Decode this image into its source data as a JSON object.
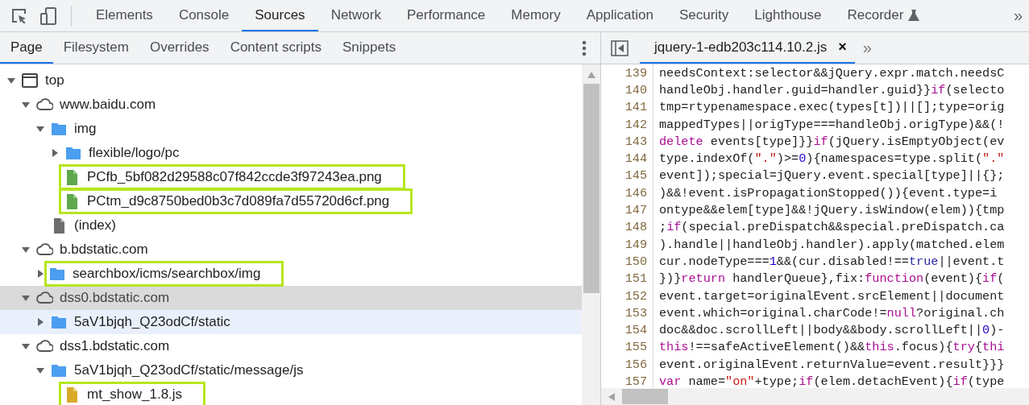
{
  "toolbar": {
    "tabs": [
      {
        "label": "Elements",
        "selected": false
      },
      {
        "label": "Console",
        "selected": false
      },
      {
        "label": "Sources",
        "selected": true
      },
      {
        "label": "Network",
        "selected": false
      },
      {
        "label": "Performance",
        "selected": false
      },
      {
        "label": "Memory",
        "selected": false
      },
      {
        "label": "Application",
        "selected": false
      },
      {
        "label": "Security",
        "selected": false
      },
      {
        "label": "Lighthouse",
        "selected": false
      },
      {
        "label": "Recorder",
        "selected": false,
        "experimental": true
      }
    ],
    "more": "»"
  },
  "navigator": {
    "tabs": [
      {
        "label": "Page",
        "selected": true
      },
      {
        "label": "Filesystem",
        "selected": false
      },
      {
        "label": "Overrides",
        "selected": false
      },
      {
        "label": "Content scripts",
        "selected": false
      },
      {
        "label": "Snippets",
        "selected": false
      }
    ],
    "tree": [
      {
        "label": "top",
        "kind": "frame",
        "expanded": true,
        "selected": false,
        "hovered": false,
        "annotated": false,
        "children": [
          {
            "label": "www.baidu.com",
            "kind": "domain",
            "expanded": true,
            "selected": false,
            "hovered": false,
            "annotated": false,
            "children": [
              {
                "label": "img",
                "kind": "folder",
                "expanded": true,
                "selected": false,
                "hovered": false,
                "annotated": false,
                "children": [
                  {
                    "label": "flexible/logo/pc",
                    "kind": "folder",
                    "expanded": false,
                    "selected": false,
                    "hovered": false,
                    "annotated": false
                  },
                  {
                    "label": "PCfb_5bf082d29588c07f842ccde3f97243ea.png",
                    "kind": "image",
                    "selected": false,
                    "hovered": false,
                    "annotated": true
                  },
                  {
                    "label": "PCtm_d9c8750bed0b3c7d089fa7d55720d6cf.png",
                    "kind": "image",
                    "selected": false,
                    "hovered": false,
                    "annotated": true
                  }
                ]
              },
              {
                "label": "(index)",
                "kind": "document",
                "selected": false,
                "hovered": false,
                "annotated": false
              }
            ]
          },
          {
            "label": "b.bdstatic.com",
            "kind": "domain",
            "expanded": true,
            "selected": false,
            "hovered": false,
            "annotated": false,
            "children": [
              {
                "label": "searchbox/icms/searchbox/img",
                "kind": "folder",
                "expanded": false,
                "selected": false,
                "hovered": false,
                "annotated": true
              }
            ]
          },
          {
            "label": "dss0.bdstatic.com",
            "kind": "domain",
            "expanded": true,
            "selected": true,
            "hovered": false,
            "annotated": false,
            "children": [
              {
                "label": "5aV1bjqh_Q23odCf/static",
                "kind": "folder",
                "expanded": false,
                "selected": false,
                "hovered": true,
                "annotated": false
              }
            ]
          },
          {
            "label": "dss1.bdstatic.com",
            "kind": "domain",
            "expanded": true,
            "selected": false,
            "hovered": false,
            "annotated": false,
            "children": [
              {
                "label": "5aV1bjqh_Q23odCf/static/message/js",
                "kind": "folder",
                "expanded": true,
                "selected": false,
                "hovered": false,
                "annotated": false,
                "children": [
                  {
                    "label": "mt_show_1.8.js",
                    "kind": "script",
                    "selected": false,
                    "hovered": false,
                    "annotated": true
                  }
                ]
              }
            ]
          }
        ]
      }
    ]
  },
  "editor": {
    "tabs": [
      {
        "label": "jquery-1-edb203c114.10.2.js",
        "selected": true,
        "close": "×"
      }
    ],
    "more": "»",
    "lines": [
      {
        "number": "139",
        "tokens": [
          {
            "kind": "plain",
            "text": "needsContext:selector&&jQuery.expr.match.needsC"
          }
        ]
      },
      {
        "number": "140",
        "tokens": [
          {
            "kind": "plain",
            "text": "handleObj.handler.guid=handler.guid}}"
          },
          {
            "kind": "keyword",
            "text": "if"
          },
          {
            "kind": "plain",
            "text": "(selecto"
          }
        ]
      },
      {
        "number": "141",
        "tokens": [
          {
            "kind": "plain",
            "text": "tmp=rtypenamespace.exec(types[t])||[];type=orig"
          }
        ]
      },
      {
        "number": "142",
        "tokens": [
          {
            "kind": "plain",
            "text": "mappedTypes||origType===handleObj.origType)&&(!"
          }
        ]
      },
      {
        "number": "143",
        "tokens": [
          {
            "kind": "keyword",
            "text": "delete"
          },
          {
            "kind": "plain",
            "text": " events[type]}}"
          },
          {
            "kind": "keyword",
            "text": "if"
          },
          {
            "kind": "plain",
            "text": "(jQuery.isEmptyObject(ev"
          }
        ]
      },
      {
        "number": "144",
        "tokens": [
          {
            "kind": "plain",
            "text": "type.indexOf("
          },
          {
            "kind": "string",
            "text": "\".\""
          },
          {
            "kind": "plain",
            "text": ")>="
          },
          {
            "kind": "number",
            "text": "0"
          },
          {
            "kind": "plain",
            "text": "){namespaces=type.split("
          },
          {
            "kind": "string",
            "text": "\".\""
          }
        ]
      },
      {
        "number": "145",
        "tokens": [
          {
            "kind": "plain",
            "text": "event]);special=jQuery.event.special[type]||{};"
          }
        ]
      },
      {
        "number": "146",
        "tokens": [
          {
            "kind": "plain",
            "text": ")&&!event.isPropagationStopped()){event.type=i"
          }
        ]
      },
      {
        "number": "147",
        "tokens": [
          {
            "kind": "plain",
            "text": "ontype&&elem[type]&&!jQuery.isWindow(elem)){tmp"
          }
        ]
      },
      {
        "number": "148",
        "tokens": [
          {
            "kind": "plain",
            "text": ";"
          },
          {
            "kind": "keyword",
            "text": "if"
          },
          {
            "kind": "plain",
            "text": "(special.preDispatch&&special.preDispatch.ca"
          }
        ]
      },
      {
        "number": "149",
        "tokens": [
          {
            "kind": "plain",
            "text": ").handle||handleObj.handler).apply(matched.elem"
          }
        ]
      },
      {
        "number": "150",
        "tokens": [
          {
            "kind": "plain",
            "text": "cur.nodeType==="
          },
          {
            "kind": "number",
            "text": "1"
          },
          {
            "kind": "plain",
            "text": "&&(cur.disabled!=="
          },
          {
            "kind": "atom",
            "text": "true"
          },
          {
            "kind": "plain",
            "text": "||event.t"
          }
        ]
      },
      {
        "number": "151",
        "tokens": [
          {
            "kind": "plain",
            "text": "})}"
          },
          {
            "kind": "keyword",
            "text": "return"
          },
          {
            "kind": "plain",
            "text": " handlerQueue},fix:"
          },
          {
            "kind": "keyword",
            "text": "function"
          },
          {
            "kind": "plain",
            "text": "(event){"
          },
          {
            "kind": "keyword",
            "text": "if"
          },
          {
            "kind": "plain",
            "text": "("
          }
        ]
      },
      {
        "number": "152",
        "tokens": [
          {
            "kind": "plain",
            "text": "event.target=originalEvent.srcElement||document"
          }
        ]
      },
      {
        "number": "153",
        "tokens": [
          {
            "kind": "plain",
            "text": "event.which=original.charCode!="
          },
          {
            "kind": "keyword",
            "text": "null"
          },
          {
            "kind": "plain",
            "text": "?original.ch"
          }
        ]
      },
      {
        "number": "154",
        "tokens": [
          {
            "kind": "plain",
            "text": "doc&&doc.scrollLeft||body&&body.scrollLeft||"
          },
          {
            "kind": "number",
            "text": "0"
          },
          {
            "kind": "plain",
            "text": ")-"
          }
        ]
      },
      {
        "number": "155",
        "tokens": [
          {
            "kind": "keyword",
            "text": "this"
          },
          {
            "kind": "plain",
            "text": "!==safeActiveElement()&&"
          },
          {
            "kind": "keyword",
            "text": "this"
          },
          {
            "kind": "plain",
            "text": ".focus){"
          },
          {
            "kind": "keyword",
            "text": "try"
          },
          {
            "kind": "plain",
            "text": "{"
          },
          {
            "kind": "keyword",
            "text": "thi"
          }
        ]
      },
      {
        "number": "156",
        "tokens": [
          {
            "kind": "plain",
            "text": "event.originalEvent.returnValue=event.result}}}"
          }
        ]
      },
      {
        "number": "157",
        "tokens": [
          {
            "kind": "keyword",
            "text": "var"
          },
          {
            "kind": "plain",
            "text": " name="
          },
          {
            "kind": "string",
            "text": "\"on\""
          },
          {
            "kind": "plain",
            "text": "+type;"
          },
          {
            "kind": "keyword",
            "text": "if"
          },
          {
            "kind": "plain",
            "text": "(elem.detachEvent){"
          },
          {
            "kind": "keyword",
            "text": "if"
          },
          {
            "kind": "plain",
            "text": "(type"
          }
        ]
      }
    ]
  }
}
